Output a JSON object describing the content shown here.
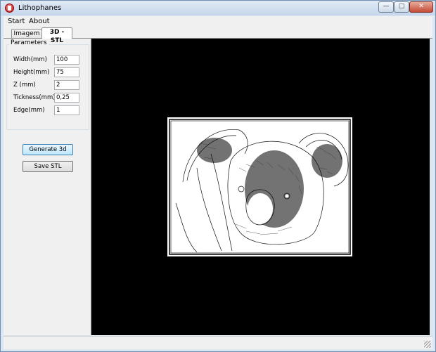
{
  "window": {
    "title": "Lithophanes"
  },
  "window_controls": {
    "minimize": "—",
    "maximize": "□",
    "close": "✕"
  },
  "menu": {
    "items": [
      {
        "label": "Start"
      },
      {
        "label": "About"
      }
    ]
  },
  "tabs": [
    {
      "label": "Imagem"
    },
    {
      "label": "3D - STL"
    }
  ],
  "parameters": {
    "title": "Parameters",
    "fields": [
      {
        "label": "Width(mm)",
        "value": "100"
      },
      {
        "label": "Height(mm)",
        "value": "75"
      },
      {
        "label": "Z (mm)",
        "value": "2"
      },
      {
        "label": "Tickness(mm)",
        "value": "0,25"
      },
      {
        "label": "Edge(mm)",
        "value": "1"
      }
    ]
  },
  "actions": {
    "generate_label": "Generate 3d",
    "save_label": "Save STL"
  },
  "preview": {
    "subject": "koala-sketch"
  }
}
